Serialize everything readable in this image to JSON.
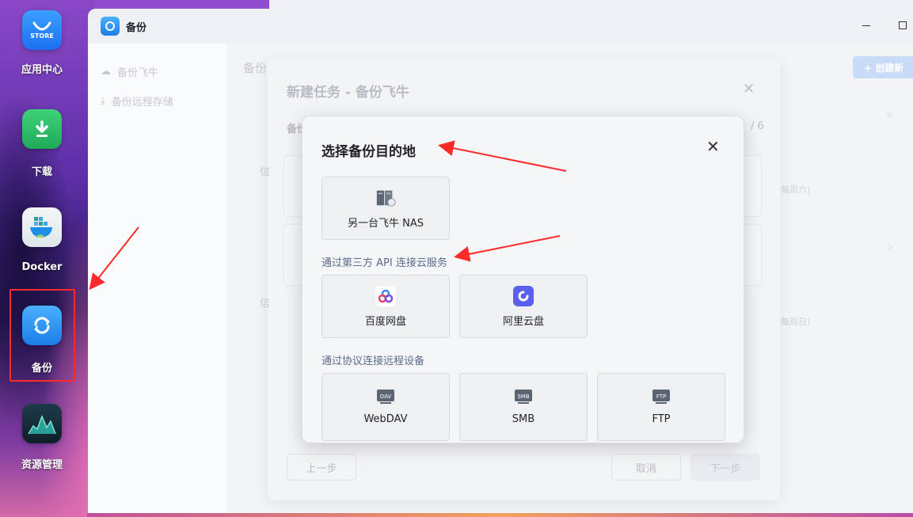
{
  "desktop": {
    "items": [
      {
        "label": "应用中心",
        "icon": "store-icon",
        "store_text": "STORE"
      },
      {
        "label": "下载",
        "icon": "download-icon"
      },
      {
        "label": "Docker",
        "icon": "docker-icon"
      },
      {
        "label": "备份",
        "icon": "backup-icon"
      },
      {
        "label": "资源管理",
        "icon": "resource-monitor-icon"
      }
    ]
  },
  "window": {
    "title": "备份",
    "sidebar": {
      "items": [
        {
          "label": "备份飞牛",
          "icon": "cloud-upload-icon"
        },
        {
          "label": "备份远程存储",
          "icon": "download-icon"
        }
      ]
    },
    "main_title": "备份",
    "create_button": "+ 创建新",
    "week_labels": [
      "每周六)",
      "每周日)"
    ]
  },
  "wizard": {
    "title": "新建任务 - 备份飞牛",
    "subtitle": "备份",
    "step": "/ 6",
    "card_marks": [
      "信",
      "信"
    ],
    "prev_button": "上一步",
    "cancel_button": "取消",
    "next_button": "下一步"
  },
  "modal": {
    "title": "选择备份目的地",
    "sections": [
      {
        "label": "",
        "tiles": [
          {
            "label": "另一台飞牛 NAS",
            "icon": "nas-server-icon"
          }
        ]
      },
      {
        "label": "通过第三方 API 连接云服务",
        "tiles": [
          {
            "label": "百度网盘",
            "icon": "baidu-netdisk-icon"
          },
          {
            "label": "阿里云盘",
            "icon": "aliyun-drive-icon"
          }
        ]
      },
      {
        "label": "通过协议连接远程设备",
        "tiles": [
          {
            "label": "WebDAV",
            "icon": "webdav-icon",
            "badge": "DAV"
          },
          {
            "label": "SMB",
            "icon": "smb-icon",
            "badge": "SMB"
          },
          {
            "label": "FTP",
            "icon": "ftp-icon",
            "badge": "FTP"
          }
        ]
      }
    ]
  },
  "colors": {
    "accent": "#1c7de8",
    "annotation": "#ff2a2a"
  }
}
